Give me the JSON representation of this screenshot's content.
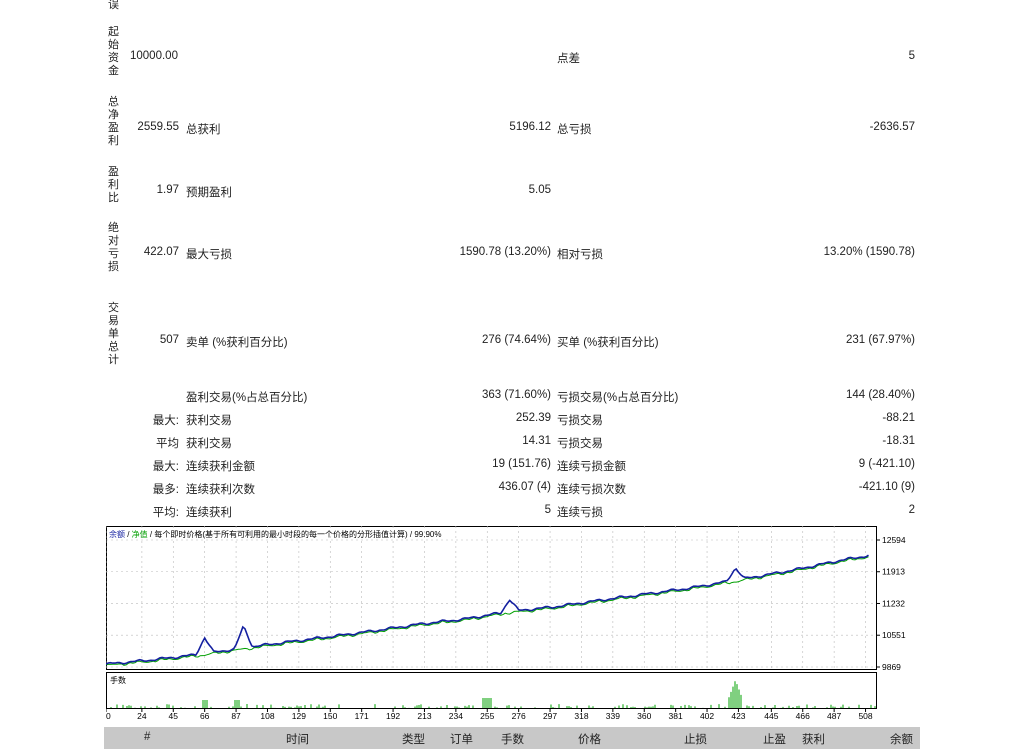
{
  "top_fragment": "误",
  "section_labels": {
    "initial": "起始资金",
    "netprofit": "总净盈利",
    "profitfactor": "盈利比",
    "absdd": "绝对亏损",
    "trades": "交易单总计"
  },
  "row_initial": {
    "value": "10000.00",
    "spread_label": "点差",
    "spread_value": "5"
  },
  "row_net": {
    "value": "2559.55",
    "gross_profit_label": "总获利",
    "gross_profit_value": "5196.12",
    "gross_loss_label": "总亏损",
    "gross_loss_value": "-2636.57"
  },
  "row_pf": {
    "value": "1.97",
    "expected_label": "预期盈利",
    "expected_value": "5.05"
  },
  "row_dd": {
    "value": "422.07",
    "max_dd_label": "最大亏损",
    "max_dd_value": "1590.78 (13.20%)",
    "rel_dd_label": "相对亏损",
    "rel_dd_value": "13.20% (1590.78)"
  },
  "row_trades": {
    "value": "507",
    "short_label": "卖单 (%获利百分比)",
    "short_value": "276 (74.64%)",
    "long_label": "买单 (%获利百分比)",
    "long_value": "231 (67.97%)"
  },
  "stats": [
    {
      "prefix": "",
      "label": "盈利交易(%占总百分比)",
      "value": "363 (71.60%)",
      "label2": "亏损交易(%占总百分比)",
      "value2": "144 (28.40%)"
    },
    {
      "prefix": "最大:",
      "label": "获利交易",
      "value": "252.39",
      "label2": "亏损交易",
      "value2": "-88.21"
    },
    {
      "prefix": "平均",
      "label": "获利交易",
      "value": "14.31",
      "label2": "亏损交易",
      "value2": "-18.31"
    },
    {
      "prefix": "最大:",
      "label": "连续获利金额",
      "value": "19 (151.76)",
      "label2": "连续亏损金额",
      "value2": "9 (-421.10)"
    },
    {
      "prefix": "最多:",
      "label": "连续获利次数",
      "value": "436.07 (4)",
      "label2": "连续亏损次数",
      "value2": "-421.10 (9)"
    },
    {
      "prefix": "平均:",
      "label": "连续获利",
      "value": "5",
      "label2": "连续亏损",
      "value2": "2"
    }
  ],
  "chart_data": {
    "type": "line",
    "legend_balance": "余额",
    "legend_sep1": " / ",
    "legend_equity": "净值",
    "legend_rest": " / 每个即时价格(基于所有可利用的最小时段的每一个价格的分形插值计算) / 99.90%",
    "lots_label": "手数",
    "y_ticks": [
      "12594",
      "11913",
      "11232",
      "10551",
      "9869"
    ],
    "x_ticks": [
      "0",
      "24",
      "45",
      "66",
      "87",
      "108",
      "129",
      "150",
      "171",
      "192",
      "213",
      "234",
      "255",
      "276",
      "297",
      "318",
      "339",
      "360",
      "381",
      "402",
      "423",
      "445",
      "466",
      "487",
      "508"
    ],
    "ylim": [
      9869,
      12594
    ],
    "xlim": [
      0,
      515
    ],
    "balance": [
      [
        0,
        9930
      ],
      [
        30,
        10020
      ],
      [
        60,
        10130
      ],
      [
        90,
        10270
      ],
      [
        120,
        10400
      ],
      [
        150,
        10520
      ],
      [
        180,
        10650
      ],
      [
        210,
        10790
      ],
      [
        240,
        10900
      ],
      [
        270,
        11060
      ],
      [
        300,
        11160
      ],
      [
        330,
        11300
      ],
      [
        360,
        11430
      ],
      [
        390,
        11560
      ],
      [
        410,
        11670
      ],
      [
        430,
        11780
      ],
      [
        460,
        11950
      ],
      [
        490,
        12150
      ],
      [
        510,
        12260
      ]
    ],
    "spikes": [
      [
        66,
        10500
      ],
      [
        92,
        10750
      ],
      [
        270,
        11320
      ],
      [
        421,
        12000
      ]
    ],
    "equity_color": "#00a000",
    "balance_color": "#1420a0",
    "volume_color": "#00a000"
  },
  "table_headers": [
    "#",
    "时间",
    "类型",
    "订单",
    "手数",
    "价格",
    "止损",
    "止盈",
    "获利",
    "余额"
  ]
}
